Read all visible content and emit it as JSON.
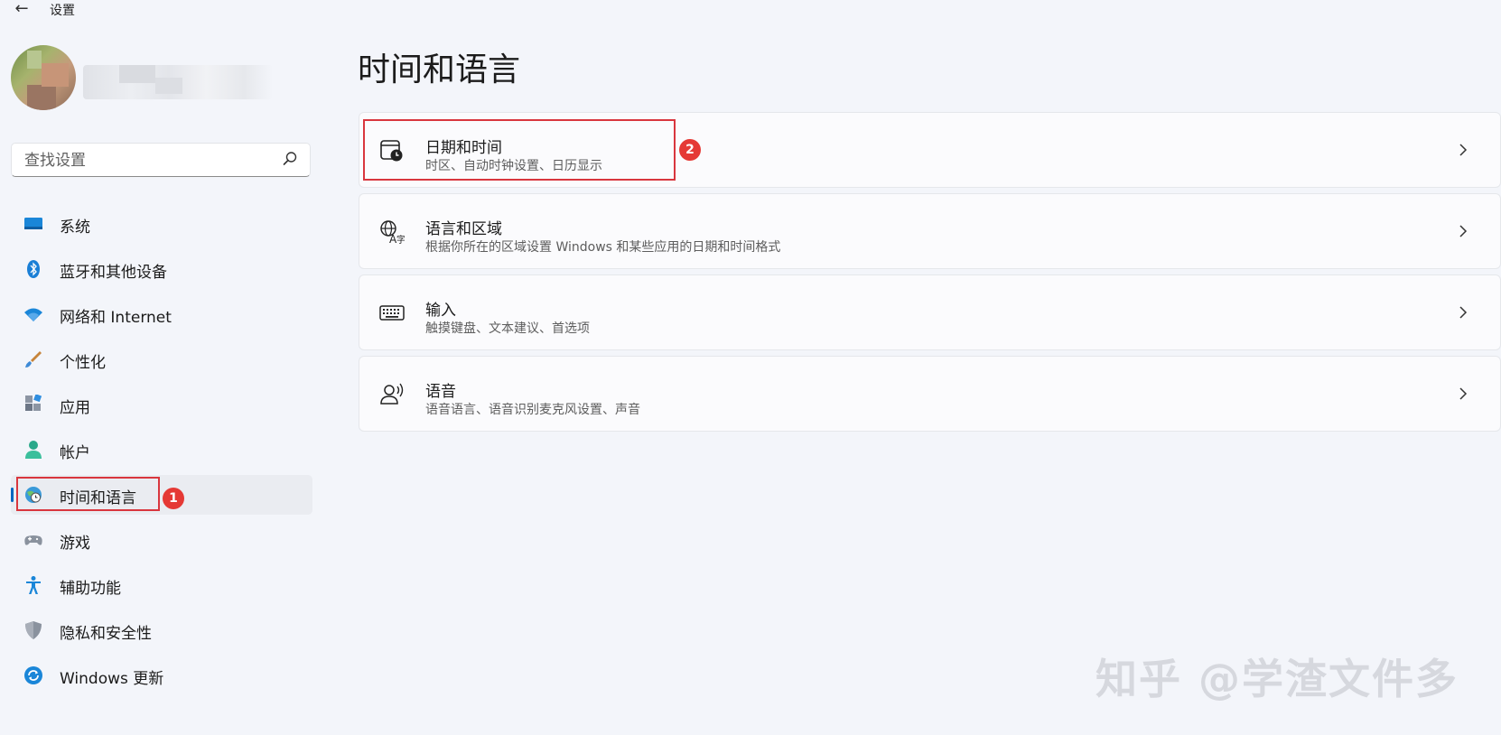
{
  "app": {
    "title": "设置",
    "back_icon": "arrow-left-icon"
  },
  "search": {
    "placeholder": "查找设置",
    "value": ""
  },
  "sidebar": {
    "items": [
      {
        "label": "系统",
        "icon": "monitor-icon"
      },
      {
        "label": "蓝牙和其他设备",
        "icon": "bluetooth-icon"
      },
      {
        "label": "网络和 Internet",
        "icon": "wifi-icon"
      },
      {
        "label": "个性化",
        "icon": "brush-icon"
      },
      {
        "label": "应用",
        "icon": "apps-icon"
      },
      {
        "label": "帐户",
        "icon": "person-icon"
      },
      {
        "label": "时间和语言",
        "icon": "globe-clock-icon",
        "active": true
      },
      {
        "label": "游戏",
        "icon": "gamepad-icon"
      },
      {
        "label": "辅助功能",
        "icon": "accessibility-icon"
      },
      {
        "label": "隐私和安全性",
        "icon": "shield-icon"
      },
      {
        "label": "Windows 更新",
        "icon": "update-icon"
      }
    ]
  },
  "annotations": {
    "badge1": "1",
    "badge2": "2"
  },
  "main": {
    "title": "时间和语言",
    "cards": [
      {
        "title": "日期和时间",
        "subtitle": "时区、自动时钟设置、日历显示",
        "icon": "calendar-clock-icon"
      },
      {
        "title": "语言和区域",
        "subtitle": "根据你所在的区域设置 Windows 和某些应用的日期和时间格式",
        "icon": "language-icon"
      },
      {
        "title": "输入",
        "subtitle": "触摸键盘、文本建议、首选项",
        "icon": "keyboard-icon"
      },
      {
        "title": "语音",
        "subtitle": "语音语言、语音识别麦克风设置、声音",
        "icon": "speech-icon"
      }
    ]
  },
  "watermark": "知乎 @学渣文件多",
  "colors": {
    "accent": "#0067c0",
    "highlight": "#d9363e",
    "badge": "#e53935"
  }
}
